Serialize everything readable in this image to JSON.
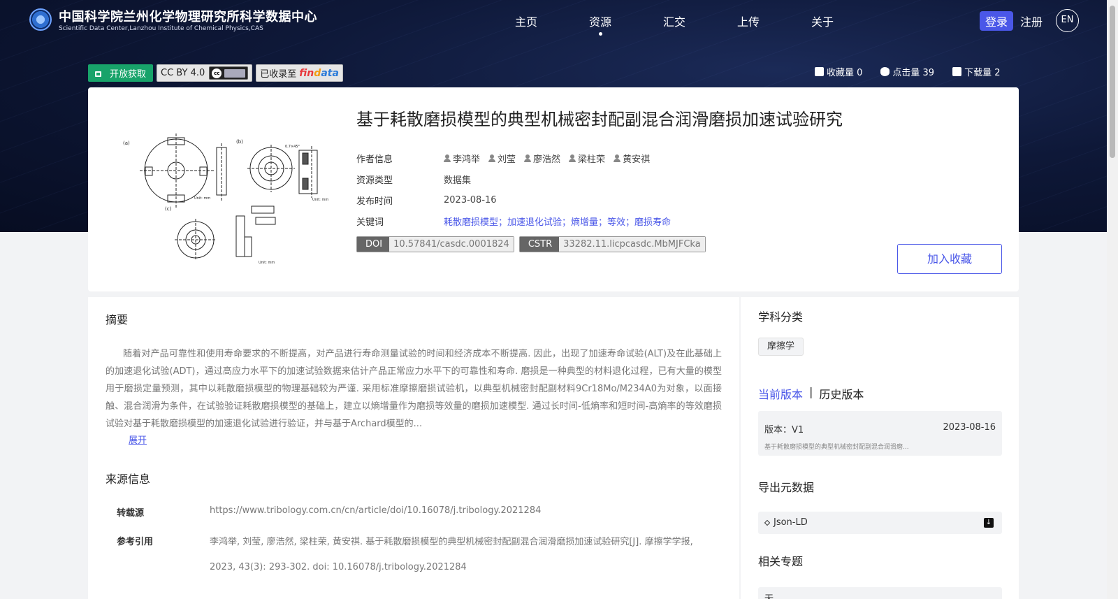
{
  "header": {
    "brand_cn": "中国科学院兰州化学物理研究所科学数据中心",
    "brand_en": "Scientific Data Center,Lanzhou Institute of Chemical Physics,CAS",
    "nav": [
      {
        "label": "主页",
        "active": false
      },
      {
        "label": "资源",
        "active": true
      },
      {
        "label": "汇交",
        "active": false
      },
      {
        "label": "上传",
        "active": false
      },
      {
        "label": "关于",
        "active": false
      }
    ],
    "login": "登录",
    "register": "注册",
    "lang": "EN"
  },
  "badges": {
    "open_access": "开放获取",
    "license": "CC BY 4.0",
    "indexed": "已收录至",
    "findata": {
      "f1": "fin",
      "f2": "d",
      "f3": "ata"
    }
  },
  "stats": {
    "favorites": "收藏量 0",
    "views": "点击量 39",
    "downloads": "下载量 2"
  },
  "dataset": {
    "title": "基于耗散磨损模型的典型机械密封配副混合润滑磨损加速试验研究",
    "labels": {
      "authors": "作者信息",
      "type": "资源类型",
      "date": "发布时间",
      "keywords": "关键词"
    },
    "authors": [
      "李鸿举",
      "刘莹",
      "廖浩然",
      "梁柱荣",
      "黄安祺"
    ],
    "type": "数据集",
    "date": "2023-08-16",
    "keywords": "耗散磨损模型；加速退化试验；熵增量；等效；磨损寿命",
    "doi": {
      "key": "DOI",
      "value": "10.57841/casdc.0001824"
    },
    "cstr": {
      "key": "CSTR",
      "value": "33282.11.licpcasdc.MbMJFCka"
    },
    "favorite_btn": "加入收藏"
  },
  "abstract": {
    "title": "摘要",
    "text": "随着对产品可靠性和使用寿命要求的不断提高，对产品进行寿命测量试验的时间和经济成本不断提高. 因此，出现了加速寿命试验(ALT)及在此基础上的加速退化试验(ADT)，通过高应力水平下的加速试验数据来估计产品正常应力水平下的可靠性和寿命. 磨损是一种典型的材料退化过程，已有大量的模型用于磨损定量预测，其中以耗散磨损模型的物理基础较为严谨. 采用标准摩擦磨损试验机，以典型机械密封配副材料9Cr18Mo/M234A0为对象，以面接触、混合润滑为条件，在试验验证耗散磨损模型的基础上，建立以熵增量作为磨损等效量的磨损加速模型. 通过长时间-低熵率和短时间-高熵率的等效磨损试验对基于耗散磨损模型的加速退化试验进行验证，并与基于Archard模型的...",
    "expand": "展开"
  },
  "source": {
    "title": "来源信息",
    "repost_label": "转载源",
    "repost_value": "https://www.tribology.com.cn/cn/article/doi/10.16078/j.tribology.2021284",
    "cite_label": "参考引用",
    "cite_line1": "李鸿举, 刘莹, 廖浩然, 梁柱荣, 黄安祺. 基于耗散磨损模型的典型机械密封配副混合润滑磨损加速试验研究[J]. 摩擦学学报,",
    "cite_line2": "2023, 43(3): 293-302. doi: 10.16078/j.tribology.2021284"
  },
  "sidebar": {
    "subject_title": "学科分类",
    "subject_tag": "摩擦学",
    "version_current": "当前版本",
    "version_sep": "|",
    "version_history": "历史版本",
    "version_label": "版本：V1",
    "version_date": "2023-08-16",
    "version_desc": "基于耗散磨损模型的典型机械密封配副混合润滑磨...",
    "export_title": "导出元数据",
    "export_format": "Json-LD",
    "topic_title": "相关专题",
    "topic_value": "无"
  },
  "colors": {
    "accent": "#4a57e8",
    "open_access": "#18a36a",
    "header_bg": "#0e1838"
  }
}
